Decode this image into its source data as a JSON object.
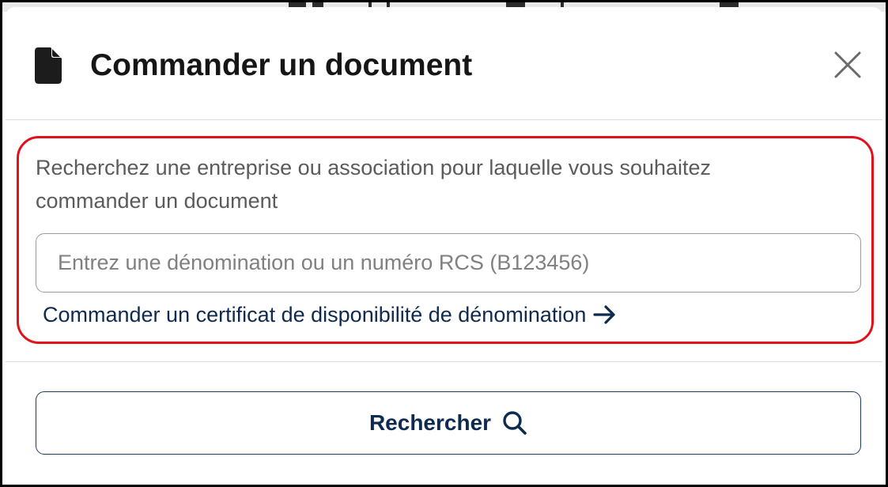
{
  "modal": {
    "title": "Commander un document",
    "title_icon": "file-icon",
    "close_icon": "close-icon"
  },
  "search": {
    "description": "Recherchez une entreprise ou association pour laquelle vous souhaitez commander un document",
    "placeholder": "Entrez une dénomination ou un numéro RCS (B123456)",
    "value": "",
    "certificate_link": "Commander un certificat de disponibilité de dénomination",
    "certificate_link_icon": "arrow-right-icon",
    "button_label": "Rechercher",
    "button_icon": "search-icon"
  },
  "colors": {
    "highlight_border": "#e0121c",
    "link_text": "#0f2a4f",
    "title_text": "#161616"
  }
}
